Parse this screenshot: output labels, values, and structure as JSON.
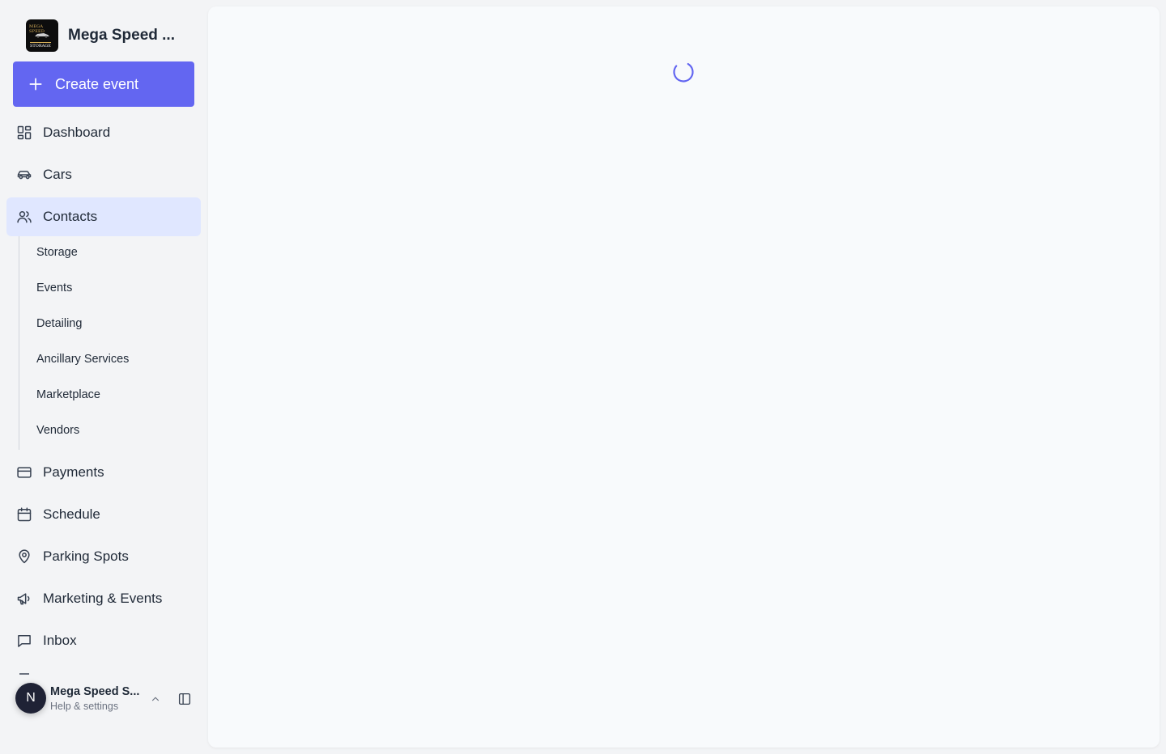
{
  "org": {
    "name": "Mega Speed ...",
    "logo_text_top": "MEGA SPEED",
    "logo_text_bottom": "STORAGE"
  },
  "create_button": {
    "label": "Create event",
    "icon": "plus-icon"
  },
  "nav": {
    "dashboard": {
      "label": "Dashboard",
      "icon": "dashboard-grid-icon"
    },
    "cars": {
      "label": "Cars",
      "icon": "car-icon"
    },
    "contacts": {
      "label": "Contacts",
      "icon": "users-icon",
      "active": true
    },
    "contacts_sub": [
      "Storage",
      "Events",
      "Detailing",
      "Ancillary Services",
      "Marketplace",
      "Vendors"
    ],
    "payments": {
      "label": "Payments",
      "icon": "credit-card-icon"
    },
    "schedule": {
      "label": "Schedule",
      "icon": "calendar-icon"
    },
    "parking_spots": {
      "label": "Parking Spots",
      "icon": "map-pin-icon"
    },
    "marketing_events": {
      "label": "Marketing & Events",
      "icon": "megaphone-icon"
    },
    "inbox": {
      "label": "Inbox",
      "icon": "message-square-icon"
    }
  },
  "user": {
    "avatar_initial": "N",
    "name": "Mega Speed S...",
    "subtitle": "Help & settings"
  },
  "colors": {
    "accent": "#6366f1",
    "active_bg": "#e0e7ff",
    "sidebar_bg": "#f3f4f6",
    "main_bg": "#f8fafc",
    "avatar_bg": "#1f2235"
  },
  "main": {
    "state": "loading",
    "spinner_icon": "loading-spinner-icon"
  }
}
